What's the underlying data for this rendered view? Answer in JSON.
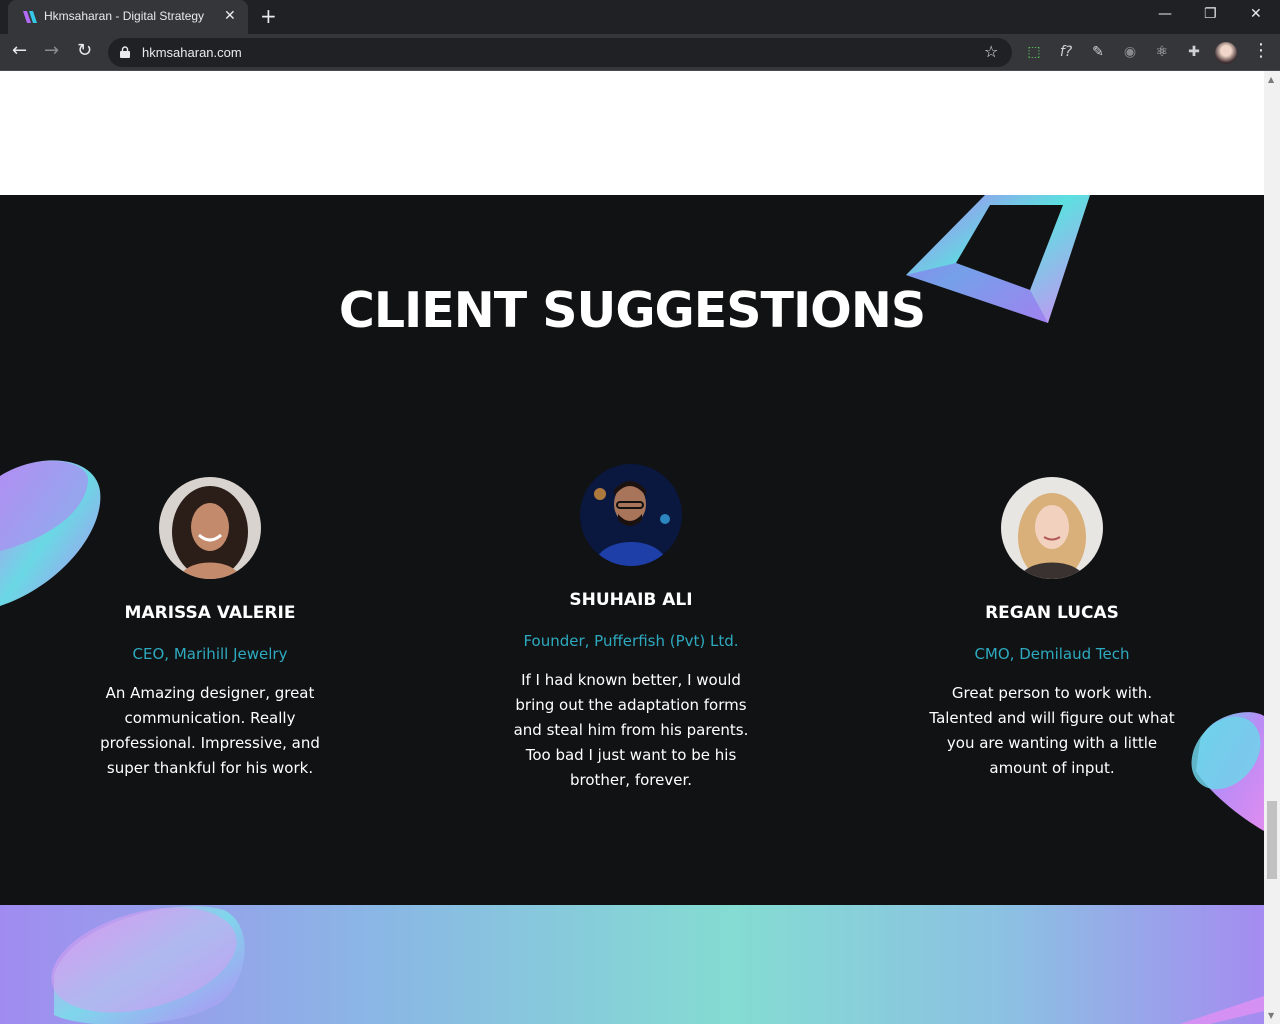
{
  "browser": {
    "tab_title": "Hkmsaharan - Digital Strategy",
    "url": "hkmsaharan.com",
    "close_tab_glyph": "✕",
    "new_tab_glyph": "+",
    "nav": {
      "back": "←",
      "forward": "→",
      "reload": "↻"
    },
    "window": {
      "minimize": "—",
      "restore": "❐",
      "close": "✕"
    },
    "extensions": [
      {
        "name": "screenshot-extension-icon",
        "glyph": "⬚"
      },
      {
        "name": "font-extension-icon",
        "glyph": "f?"
      },
      {
        "name": "pen-extension-icon",
        "glyph": "✎"
      },
      {
        "name": "mouse-extension-icon",
        "glyph": "◉"
      },
      {
        "name": "react-devtools-icon",
        "glyph": "⚛"
      },
      {
        "name": "puzzle-extensions-icon",
        "glyph": "✚"
      }
    ],
    "menu_glyph": "⋮",
    "bookmark_glyph": "☆"
  },
  "section": {
    "heading": "CLIENT SUGGESTIONS"
  },
  "testimonials": [
    {
      "name": "MARISSA VALERIE",
      "role": "CEO, Marihill Jewelry",
      "quote": "An Amazing designer, great communication. Really professional. Impressive, and super thankful for his work."
    },
    {
      "name": "SHUHAIB ALI",
      "role": "Founder, Pufferfish (Pvt) Ltd.",
      "quote": "If I had known better, I would bring out the adaptation forms and steal him from his parents. Too bad I just want to be his brother, forever."
    },
    {
      "name": "REGAN LUCAS",
      "role": "CMO, Demilaud Tech",
      "quote": "Great person to work with. Talented and will figure out what you are wanting with a little amount of input."
    }
  ],
  "colors": {
    "accent_role": "#2eaac0",
    "dark_bg": "#111213"
  }
}
